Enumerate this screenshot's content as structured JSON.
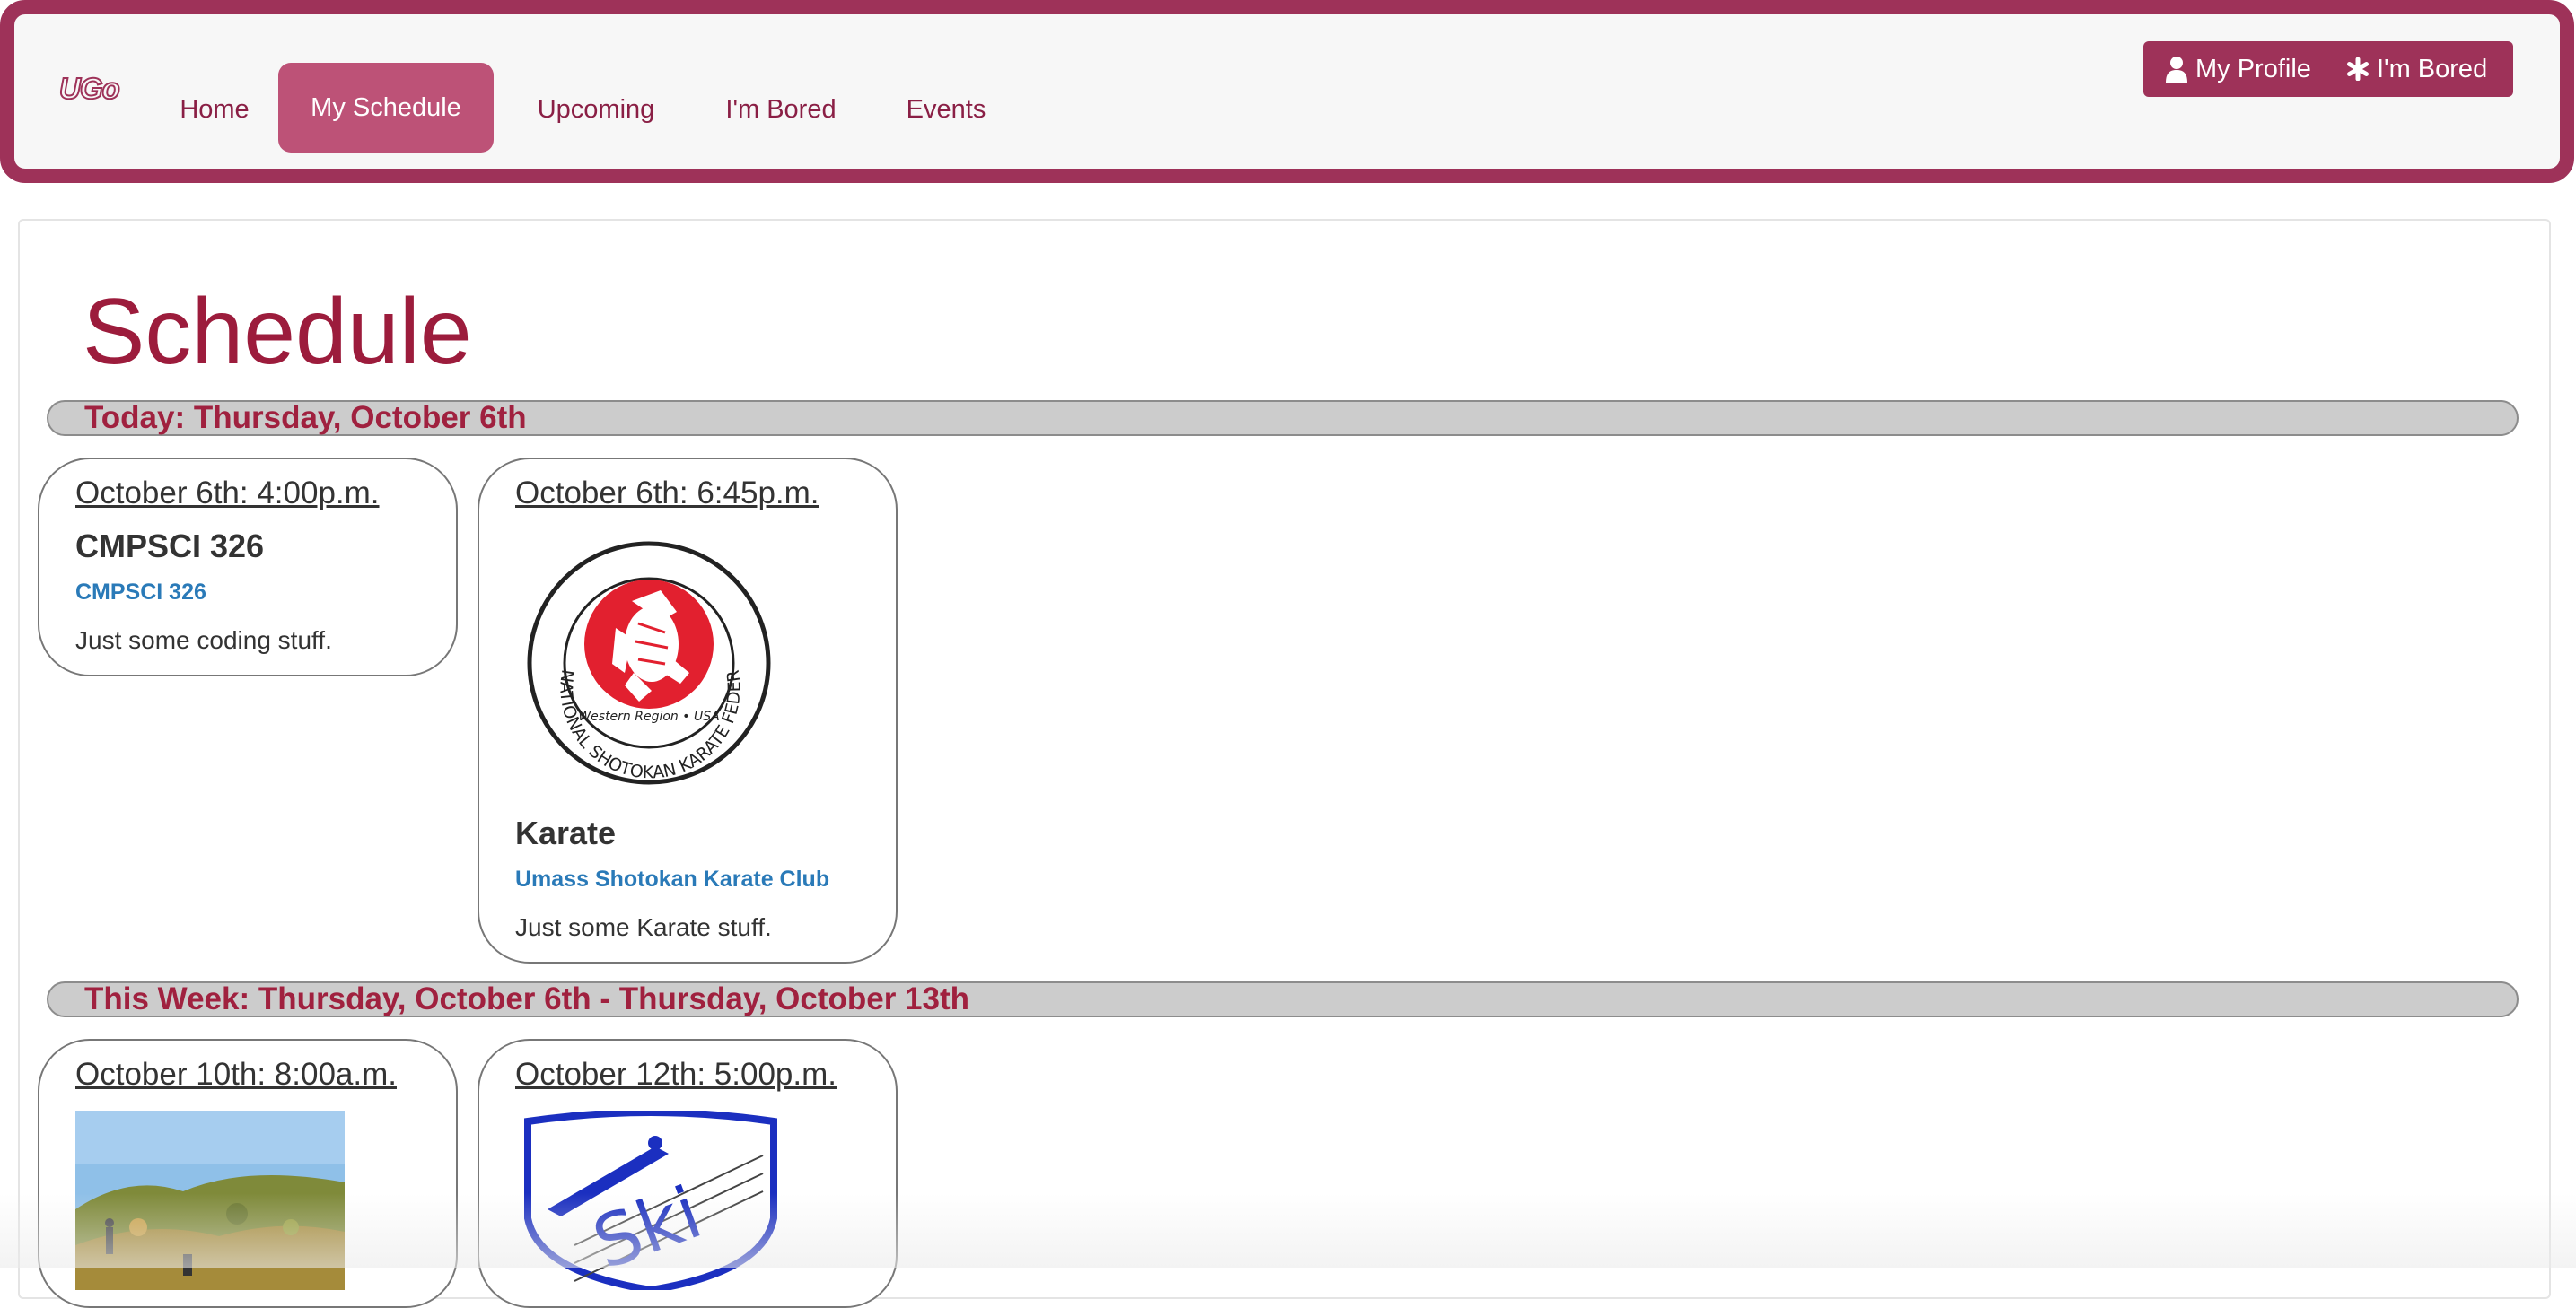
{
  "navbar": {
    "brand": "UGo",
    "links": [
      {
        "label": "Home"
      },
      {
        "label": "My Schedule",
        "active": true
      },
      {
        "label": "Upcoming"
      },
      {
        "label": "I'm Bored"
      },
      {
        "label": "Events"
      }
    ],
    "buttons": {
      "profile": {
        "label": "My Profile",
        "icon": "user-icon"
      },
      "bored": {
        "label": "I'm Bored",
        "icon": "asterisk-icon"
      }
    }
  },
  "colors": {
    "brand": "#9e3259",
    "active_nav": "#bd5277",
    "heading": "#9c1c3c",
    "link": "#2a7ab8",
    "section_bar": "#cccccc"
  },
  "main": {
    "title": "Schedule",
    "sections": [
      {
        "label": "Today: Thursday, October 6th",
        "events": [
          {
            "date": "October 6th: 4:00p.m.",
            "name": "CMPSCI 326",
            "group": "CMPSCI 326",
            "description": "Just some coding stuff."
          },
          {
            "date": "October 6th: 6:45p.m.",
            "image": "international-shotokan-karate-federation-logo",
            "logo_text": {
              "ring": "INTERNATIONAL SHOTOKAN KARATE FEDERATION",
              "region": "Western Region • USA"
            },
            "name": "Karate",
            "group": "Umass Shotokan Karate Club",
            "description": "Just some Karate stuff."
          }
        ]
      },
      {
        "label": "This Week: Thursday, October 6th - Thursday, October 13th",
        "events": [
          {
            "date": "October 10th: 8:00a.m.",
            "image": "hiking-photo"
          },
          {
            "date": "October 12th: 5:00p.m.",
            "image": "ski-club-logo",
            "logo_text": "Ski"
          }
        ]
      }
    ]
  }
}
